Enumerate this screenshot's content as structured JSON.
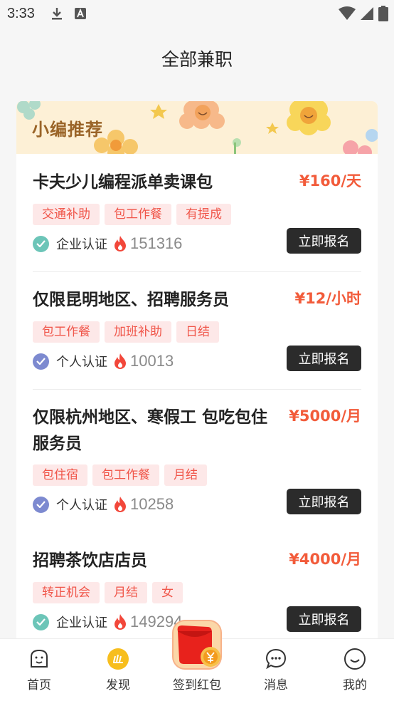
{
  "status": {
    "time": "3:33"
  },
  "page": {
    "title": "全部兼职"
  },
  "banner": {
    "title": "小编推荐"
  },
  "jobs": [
    {
      "title": "卡夫少儿编程派单卖课包",
      "salary": "¥160/天",
      "tags": [
        "交通补助",
        "包工作餐",
        "有提成"
      ],
      "verify": "企业认证",
      "verify_type": "enterprise",
      "views": "151316",
      "apply": "立即报名"
    },
    {
      "title": "仅限昆明地区、招聘服务员",
      "salary": "¥12/小时",
      "tags": [
        "包工作餐",
        "加班补助",
        "日结"
      ],
      "verify": "个人认证",
      "verify_type": "personal",
      "views": "10013",
      "apply": "立即报名"
    },
    {
      "title": "仅限杭州地区、寒假工 包吃包住服务员",
      "salary": "¥5000/月",
      "tags": [
        "包住宿",
        "包工作餐",
        "月结"
      ],
      "verify": "个人认证",
      "verify_type": "personal",
      "views": "10258",
      "apply": "立即报名"
    },
    {
      "title": "招聘茶饮店店员",
      "salary": "¥4000/月",
      "tags": [
        "转正机会",
        "月结",
        "女"
      ],
      "verify": "企业认证",
      "verify_type": "enterprise",
      "views": "149294",
      "apply": "立即报名"
    }
  ],
  "nav": {
    "home": "首页",
    "discover": "发现",
    "signin": "签到红包",
    "messages": "消息",
    "mine": "我的"
  },
  "colors": {
    "accent": "#f25b3a",
    "enterprise_badge": "#6cc5b8",
    "personal_badge": "#7d8ad0",
    "button": "#2b2b2b",
    "tag_bg": "#fde8e8",
    "tag_text": "#f0564a"
  }
}
